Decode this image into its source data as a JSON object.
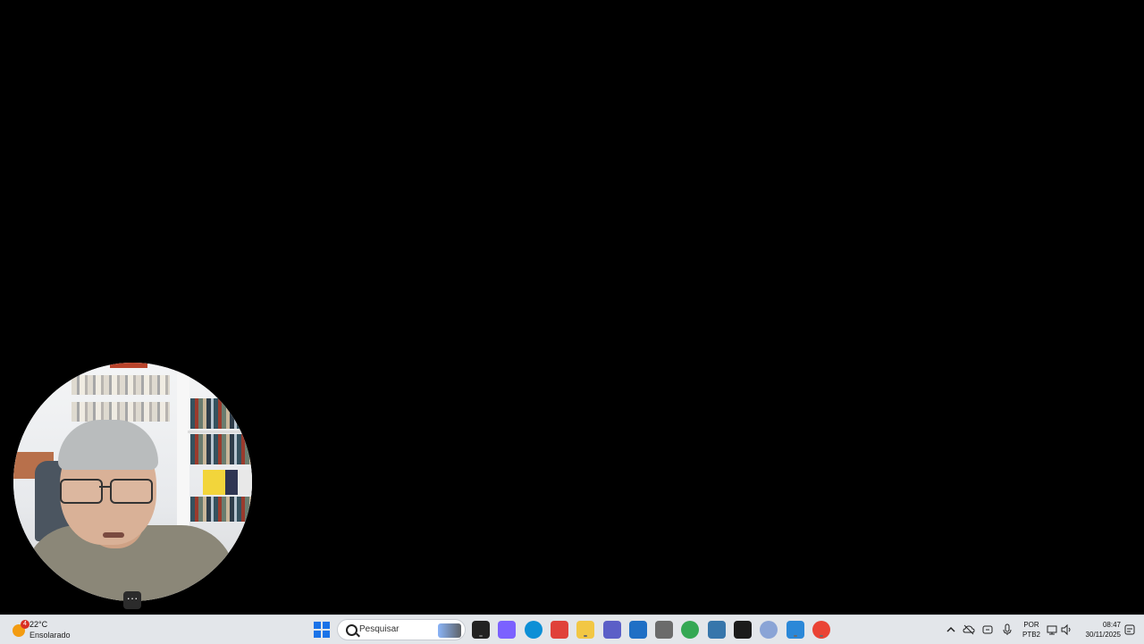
{
  "webcam": {
    "more_label": "···"
  },
  "weather": {
    "temp": "22°C",
    "condition": "Ensolarado",
    "badge_count": "4"
  },
  "search": {
    "placeholder": "Pesquisar"
  },
  "taskbar_apps": [
    {
      "name": "task-view",
      "color": "#222222"
    },
    {
      "name": "copilot",
      "color": "#7b61ff"
    },
    {
      "name": "edge",
      "color": "#0c8fd6"
    },
    {
      "name": "snipping-tool",
      "color": "#e0413a"
    },
    {
      "name": "file-explorer",
      "color": "#f2c744"
    },
    {
      "name": "teams",
      "color": "#5b5fc7"
    },
    {
      "name": "store",
      "color": "#1f6fc5"
    },
    {
      "name": "printer",
      "color": "#6b6b6b"
    },
    {
      "name": "chrome",
      "color": "#34a853"
    },
    {
      "name": "python",
      "color": "#3776ab"
    },
    {
      "name": "k-app",
      "color": "#1b1b1b"
    },
    {
      "name": "r-app",
      "color": "#8aa4d6"
    },
    {
      "name": "photos",
      "color": "#2b88d8"
    },
    {
      "name": "chrome-profile",
      "color": "#ea4335"
    }
  ],
  "tray": {
    "language_line1": "POR",
    "language_line2": "PTB2",
    "time": "08:47",
    "date": "30/11/2025"
  }
}
